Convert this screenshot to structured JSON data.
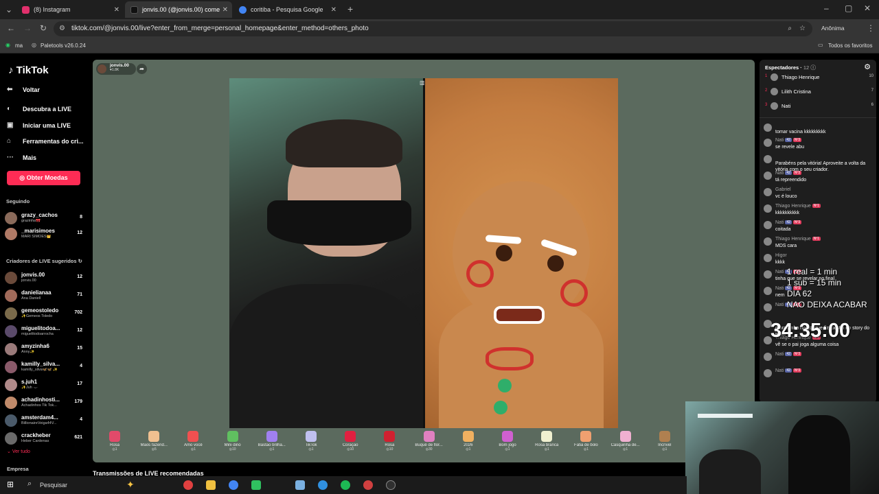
{
  "browser": {
    "tabs": [
      {
        "label": "(8) Instagram",
        "color": "#e1306c"
      },
      {
        "label": "jonvis.00 (@jonvis.00) come",
        "color": "#111111"
      },
      {
        "label": "coritiba - Pesquisa Google",
        "color": "#4285f4"
      }
    ],
    "url": "tiktok.com/@jonvis.00/live?enter_from_merge=personal_homepage&enter_method=others_photo",
    "profile": "Anônima",
    "bookmarks": [
      "ma",
      "Paletools v26.0.24"
    ],
    "favorites": "Todos os favoritos"
  },
  "sidebar": {
    "logo": "TikTok",
    "back": "Voltar",
    "items": [
      "Descubra a LIVE",
      "Iniciar uma LIVE",
      "Ferramentas do cri...",
      "Mais"
    ],
    "coins_button": "Obter Moedas",
    "following_title": "Seguindo",
    "following": [
      {
        "name": "grazy_cachos",
        "sub": "grazinha🎀",
        "count": "8",
        "color": "#8a6a5a"
      },
      {
        "name": "_marisimoes",
        "sub": "MARI SIMÕES👑",
        "count": "12",
        "color": "#b07a66"
      }
    ],
    "suggested_title": "Criadores de LIVE sugeridos",
    "suggested": [
      {
        "name": "jonvis.00",
        "sub": "jonvis.00",
        "count": "12",
        "color": "#6a4a3a"
      },
      {
        "name": "danielianaa",
        "sub": "Ana Daniell",
        "count": "71",
        "color": "#a06a5a"
      },
      {
        "name": "gemeostoledo",
        "sub": "✨Gemeos Toledo",
        "count": "702",
        "color": "#7a6a4a"
      },
      {
        "name": "miguelitodoa...",
        "sub": "miguelitodoarrocha",
        "count": "12",
        "color": "#5a4a6a"
      },
      {
        "name": "amyzinha6",
        "sub": "Anny✨",
        "count": "15",
        "color": "#9a7a7a"
      },
      {
        "name": "kamilly_silva...",
        "sub": "kamilly_silva🦋🦋 ✨",
        "count": "4",
        "color": "#8a5a6a"
      },
      {
        "name": "s.juh1",
        "sub": "✨Juh ·ᴗ·",
        "count": "17",
        "color": "#b08a8a"
      },
      {
        "name": "achadinhosti...",
        "sub": "Achadinhos Tik Tok...",
        "count": "179",
        "color": "#c08a6a"
      },
      {
        "name": "amsterdam4...",
        "sub": "BillionaireVeiga44V...",
        "count": "4",
        "color": "#4a5a6a"
      },
      {
        "name": "crackheber",
        "sub": "Heber Cardenas",
        "count": "621",
        "color": "#6a6a6a"
      }
    ],
    "see_all": "Ver tudo",
    "company": "Empresa"
  },
  "player": {
    "host_name": "jonvis.00",
    "host_likes": "1.8K",
    "gifts": [
      {
        "label": "Rosa",
        "price": "1",
        "color": "#e24a6a"
      },
      {
        "label": "Mãos fazend...",
        "price": "5",
        "color": "#f0c090"
      },
      {
        "label": "Amo você",
        "price": "1",
        "color": "#f05050"
      },
      {
        "label": "Mini dino",
        "price": "10",
        "color": "#60c060"
      },
      {
        "label": "Bastão brilha...",
        "price": "1",
        "color": "#a080f0"
      },
      {
        "label": "TikTok",
        "price": "1",
        "color": "#c0c0f0"
      },
      {
        "label": "Coração",
        "price": "10",
        "color": "#e02040"
      },
      {
        "label": "Rosa",
        "price": "10",
        "color": "#d02030"
      },
      {
        "label": "Buquê de flor...",
        "price": "30",
        "color": "#e080c0"
      },
      {
        "label": "2026",
        "price": "1",
        "color": "#f0b060"
      },
      {
        "label": "Bom jogo",
        "price": "1",
        "color": "#d060d0"
      },
      {
        "label": "Rosa branca",
        "price": "1",
        "color": "#f0f0d0"
      },
      {
        "label": "Fatia de bolo",
        "price": "1",
        "color": "#f0a070"
      },
      {
        "label": "Casquinha de...",
        "price": "1",
        "color": "#f0b0d0"
      },
      {
        "label": "Incrível",
        "price": "1",
        "color": "#b08050"
      }
    ]
  },
  "recommended": "Transmissões de LIVE recomendadas",
  "right_panel": {
    "title": "Espectadores",
    "viewer_count": "12",
    "viewers": [
      {
        "rank": "1",
        "name": "Thiago Henrique",
        "value": "10"
      },
      {
        "rank": "2",
        "name": "Lilith Cristina",
        "value": "7"
      },
      {
        "rank": "3",
        "name": "Nati",
        "value": "6"
      }
    ],
    "chat": [
      {
        "user": "",
        "msg": "tomar vacina kkkkkkkkk"
      },
      {
        "user": "Nati",
        "msg": "se revele abu"
      },
      {
        "user": "",
        "msg": "Parabéns pela vitória! Aproveite a volta da vitória com o seu criador."
      },
      {
        "user": "Nati",
        "msg": "tá repreendido"
      },
      {
        "user": "Gabriel",
        "msg": "vc é louco"
      },
      {
        "user": "Thiago Henrique",
        "msg": "kkkkkkkkkk"
      },
      {
        "user": "Nati",
        "msg": "coitada"
      },
      {
        "user": "Thiago Henrique",
        "msg": "MDS cara"
      },
      {
        "user": "Higor",
        "msg": "kkkk"
      },
      {
        "user": "Nati",
        "msg": "tinha que se revelar no final"
      },
      {
        "user": "Nati",
        "msg": "nem"
      },
      {
        "user": "Nati",
        "msg": ""
      },
      {
        "user": "",
        "msg": "moralzinha no gol que fiz, postei no story do insta"
      },
      {
        "user": "Thiago Henrique",
        "msg": "vê se o pai joga alguma coisa"
      },
      {
        "user": "Nati",
        "msg": ""
      },
      {
        "user": "Nati",
        "msg": ""
      }
    ]
  },
  "overlay": {
    "line1": "1 real = 1 min",
    "line2": "1 sub = 15 min",
    "line3": "DIA 62",
    "line4": "NAO DEIXA ACABAR",
    "timer": "34:35:00"
  },
  "taskbar": {
    "search": "Pesquisar"
  }
}
